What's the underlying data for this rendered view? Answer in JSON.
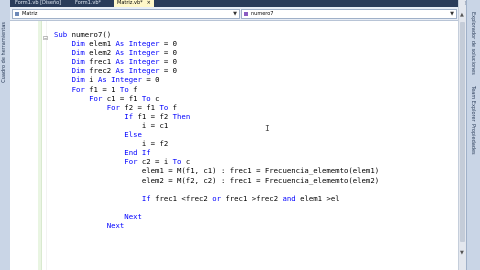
{
  "left_sidebar": {
    "label": "Cuadro de herramientas"
  },
  "tabs": [
    {
      "label": "Form1.vb [Diseño]",
      "active": false
    },
    {
      "label": "Form1.vb*",
      "active": false
    },
    {
      "label": "Matriz.vb*",
      "active": true
    }
  ],
  "combos": {
    "left": "Matriz",
    "right": "numero7"
  },
  "code_lines": [
    {
      "indent": "",
      "tokens": [
        {
          "t": "Sub",
          "k": true
        },
        {
          "t": " numero7()",
          "k": false
        }
      ]
    },
    {
      "indent": "    ",
      "tokens": [
        {
          "t": "Dim",
          "k": true
        },
        {
          "t": " elem1 ",
          "k": false
        },
        {
          "t": "As",
          "k": true
        },
        {
          "t": " ",
          "k": false
        },
        {
          "t": "Integer",
          "k": true
        },
        {
          "t": " = 0",
          "k": false
        }
      ]
    },
    {
      "indent": "    ",
      "tokens": [
        {
          "t": "Dim",
          "k": true
        },
        {
          "t": " elem2 ",
          "k": false
        },
        {
          "t": "As",
          "k": true
        },
        {
          "t": " ",
          "k": false
        },
        {
          "t": "Integer",
          "k": true
        },
        {
          "t": " = 0",
          "k": false
        }
      ]
    },
    {
      "indent": "    ",
      "tokens": [
        {
          "t": "Dim",
          "k": true
        },
        {
          "t": " frec1 ",
          "k": false
        },
        {
          "t": "As",
          "k": true
        },
        {
          "t": " ",
          "k": false
        },
        {
          "t": "Integer",
          "k": true
        },
        {
          "t": " = 0",
          "k": false
        }
      ]
    },
    {
      "indent": "    ",
      "tokens": [
        {
          "t": "Dim",
          "k": true
        },
        {
          "t": " frec2 ",
          "k": false
        },
        {
          "t": "As",
          "k": true
        },
        {
          "t": " ",
          "k": false
        },
        {
          "t": "Integer",
          "k": true
        },
        {
          "t": " = 0",
          "k": false
        }
      ]
    },
    {
      "indent": "    ",
      "tokens": [
        {
          "t": "Dim",
          "k": true
        },
        {
          "t": " i ",
          "k": false
        },
        {
          "t": "As",
          "k": true
        },
        {
          "t": " ",
          "k": false
        },
        {
          "t": "Integer",
          "k": true
        },
        {
          "t": " = 0",
          "k": false
        }
      ]
    },
    {
      "indent": "    ",
      "tokens": [
        {
          "t": "For",
          "k": true
        },
        {
          "t": " f1 = 1 ",
          "k": false
        },
        {
          "t": "To",
          "k": true
        },
        {
          "t": " f",
          "k": false
        }
      ]
    },
    {
      "indent": "        ",
      "tokens": [
        {
          "t": "For",
          "k": true
        },
        {
          "t": " c1 = f1 ",
          "k": false
        },
        {
          "t": "To",
          "k": true
        },
        {
          "t": " c",
          "k": false
        }
      ]
    },
    {
      "indent": "            ",
      "tokens": [
        {
          "t": "For",
          "k": true
        },
        {
          "t": " f2 = f1 ",
          "k": false
        },
        {
          "t": "To",
          "k": true
        },
        {
          "t": " f",
          "k": false
        }
      ]
    },
    {
      "indent": "                ",
      "tokens": [
        {
          "t": "If",
          "k": true
        },
        {
          "t": " f1 = f2 ",
          "k": false
        },
        {
          "t": "Then",
          "k": true
        }
      ]
    },
    {
      "indent": "                    ",
      "tokens": [
        {
          "t": "i = c1",
          "k": false
        }
      ]
    },
    {
      "indent": "                ",
      "tokens": [
        {
          "t": "Else",
          "k": true
        }
      ]
    },
    {
      "indent": "                    ",
      "tokens": [
        {
          "t": "i = f2",
          "k": false
        }
      ]
    },
    {
      "indent": "                ",
      "tokens": [
        {
          "t": "End If",
          "k": true
        }
      ]
    },
    {
      "indent": "                ",
      "tokens": [
        {
          "t": "For",
          "k": true
        },
        {
          "t": " c2 = i ",
          "k": false
        },
        {
          "t": "To",
          "k": true
        },
        {
          "t": " c",
          "k": false
        }
      ]
    },
    {
      "indent": "                    ",
      "tokens": [
        {
          "t": "elem1 = M(f1, c1) : frec1 = Frecuencia_elememto(elem1)",
          "k": false
        }
      ]
    },
    {
      "indent": "                    ",
      "tokens": [
        {
          "t": "elem2 = M(f2, c2) : frec1 = Frecuencia_elememto(elem2)",
          "k": false
        }
      ]
    },
    {
      "indent": "",
      "tokens": [
        {
          "t": "",
          "k": false
        }
      ]
    },
    {
      "indent": "                    ",
      "tokens": [
        {
          "t": "If",
          "k": true
        },
        {
          "t": " frec1 <frec2 ",
          "k": false
        },
        {
          "t": "or",
          "k": true
        },
        {
          "t": " frec1 >frec2 ",
          "k": false
        },
        {
          "t": "and",
          "k": true
        },
        {
          "t": " elem1 >el",
          "k": false
        }
      ]
    },
    {
      "indent": "",
      "tokens": [
        {
          "t": "",
          "k": false
        }
      ]
    },
    {
      "indent": "                ",
      "tokens": [
        {
          "t": "Next",
          "k": true
        }
      ]
    },
    {
      "indent": "            ",
      "tokens": [
        {
          "t": "Next",
          "k": true
        }
      ]
    }
  ],
  "right_sidebar": [
    {
      "label": "Explorador de soluciones"
    },
    {
      "label": "Team Explorer"
    },
    {
      "label": "Propiedades"
    }
  ]
}
